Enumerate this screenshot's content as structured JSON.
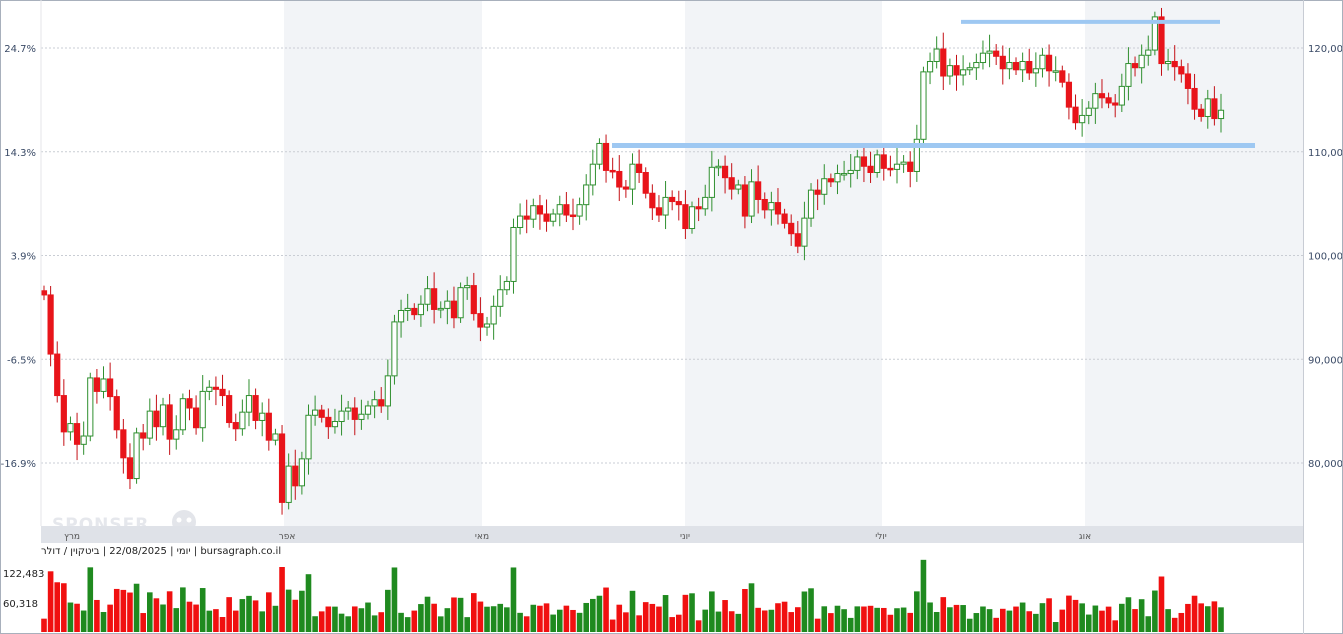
{
  "chart_data": {
    "type": "candlestick",
    "title": "",
    "info_line": "יומי | 22/08/2025 | ביטקוין / דולר | bursagraph.co.il",
    "watermark": "SPONSER",
    "x_months": [
      "מרץ",
      "אפר",
      "מאי",
      "יוני",
      "יולי",
      "אוג"
    ],
    "y_right": {
      "ticks": [
        80000,
        90000,
        100000,
        110000,
        120000
      ],
      "tick_labels": [
        "80,000",
        "90,000",
        "100,000",
        "110,000",
        "120,000"
      ]
    },
    "y_left": {
      "ticks": [
        -16.9,
        -6.5,
        3.9,
        14.3,
        24.7
      ],
      "tick_labels": [
        "-16.9%",
        "-6.5%",
        "3.9%",
        "14.3%",
        "24.7%"
      ]
    },
    "volume": {
      "tick_labels": [
        "122,483",
        "60,318"
      ],
      "ticks": [
        122483,
        60318
      ]
    },
    "close_series": [
      96200,
      90500,
      86500,
      83000,
      83800,
      81800,
      82600,
      88200,
      86900,
      88100,
      86400,
      83200,
      80500,
      78500,
      82900,
      82400,
      85000,
      83500,
      85600,
      82300,
      83200,
      86200,
      85300,
      83400,
      86900,
      87300,
      87100,
      86500,
      83900,
      83300,
      84900,
      86500,
      84100,
      84800,
      82200,
      82800,
      76200,
      79700,
      77800,
      80400,
      84600,
      85100,
      84400,
      83500,
      84000,
      85000,
      85300,
      84200,
      84700,
      85500,
      86100,
      85500,
      88400,
      93600,
      94700,
      94900,
      94300,
      95300,
      96800,
      94800,
      94900,
      95600,
      94000,
      96900,
      97100,
      94400,
      93100,
      93400,
      95100,
      96700,
      97500,
      102700,
      103800,
      103500,
      104800,
      104000,
      103300,
      104000,
      104900,
      103900,
      103800,
      104900,
      106800,
      108800,
      110800,
      108200,
      108100,
      106600,
      106400,
      108800,
      108000,
      106000,
      104600,
      103900,
      105600,
      105200,
      104900,
      102600,
      104700,
      104500,
      105600,
      108500,
      108600,
      107500,
      106400,
      106800,
      103800,
      107100,
      105400,
      104400,
      105100,
      104000,
      103100,
      102100,
      100900,
      103600,
      106300,
      105900,
      107400,
      107100,
      107900,
      107900,
      108200,
      109500,
      108600,
      108000,
      109700,
      108400,
      108300,
      108800,
      109000,
      108100,
      111200,
      117700,
      118700,
      119900,
      117300,
      118300,
      117400,
      117900,
      118100,
      118600,
      119500,
      119700,
      119200,
      118000,
      118600,
      117900,
      118700,
      117600,
      118000,
      119300,
      117800,
      117800,
      116700,
      114300,
      112800,
      113500,
      114200,
      115600,
      115200,
      114700,
      114500,
      116300,
      118500,
      118100,
      119300,
      119800,
      123000,
      118500,
      118700,
      118200,
      117500,
      116100,
      114100,
      113400,
      115100,
      113200,
      114000
    ],
    "close_first": 96200,
    "close_last": 114000,
    "close_high": 124300,
    "close_low": 74500,
    "trend_lines": [
      {
        "from": 110600,
        "to": 110600,
        "label": ""
      },
      {
        "from": 122900,
        "to": 122900,
        "label": ""
      }
    ]
  }
}
